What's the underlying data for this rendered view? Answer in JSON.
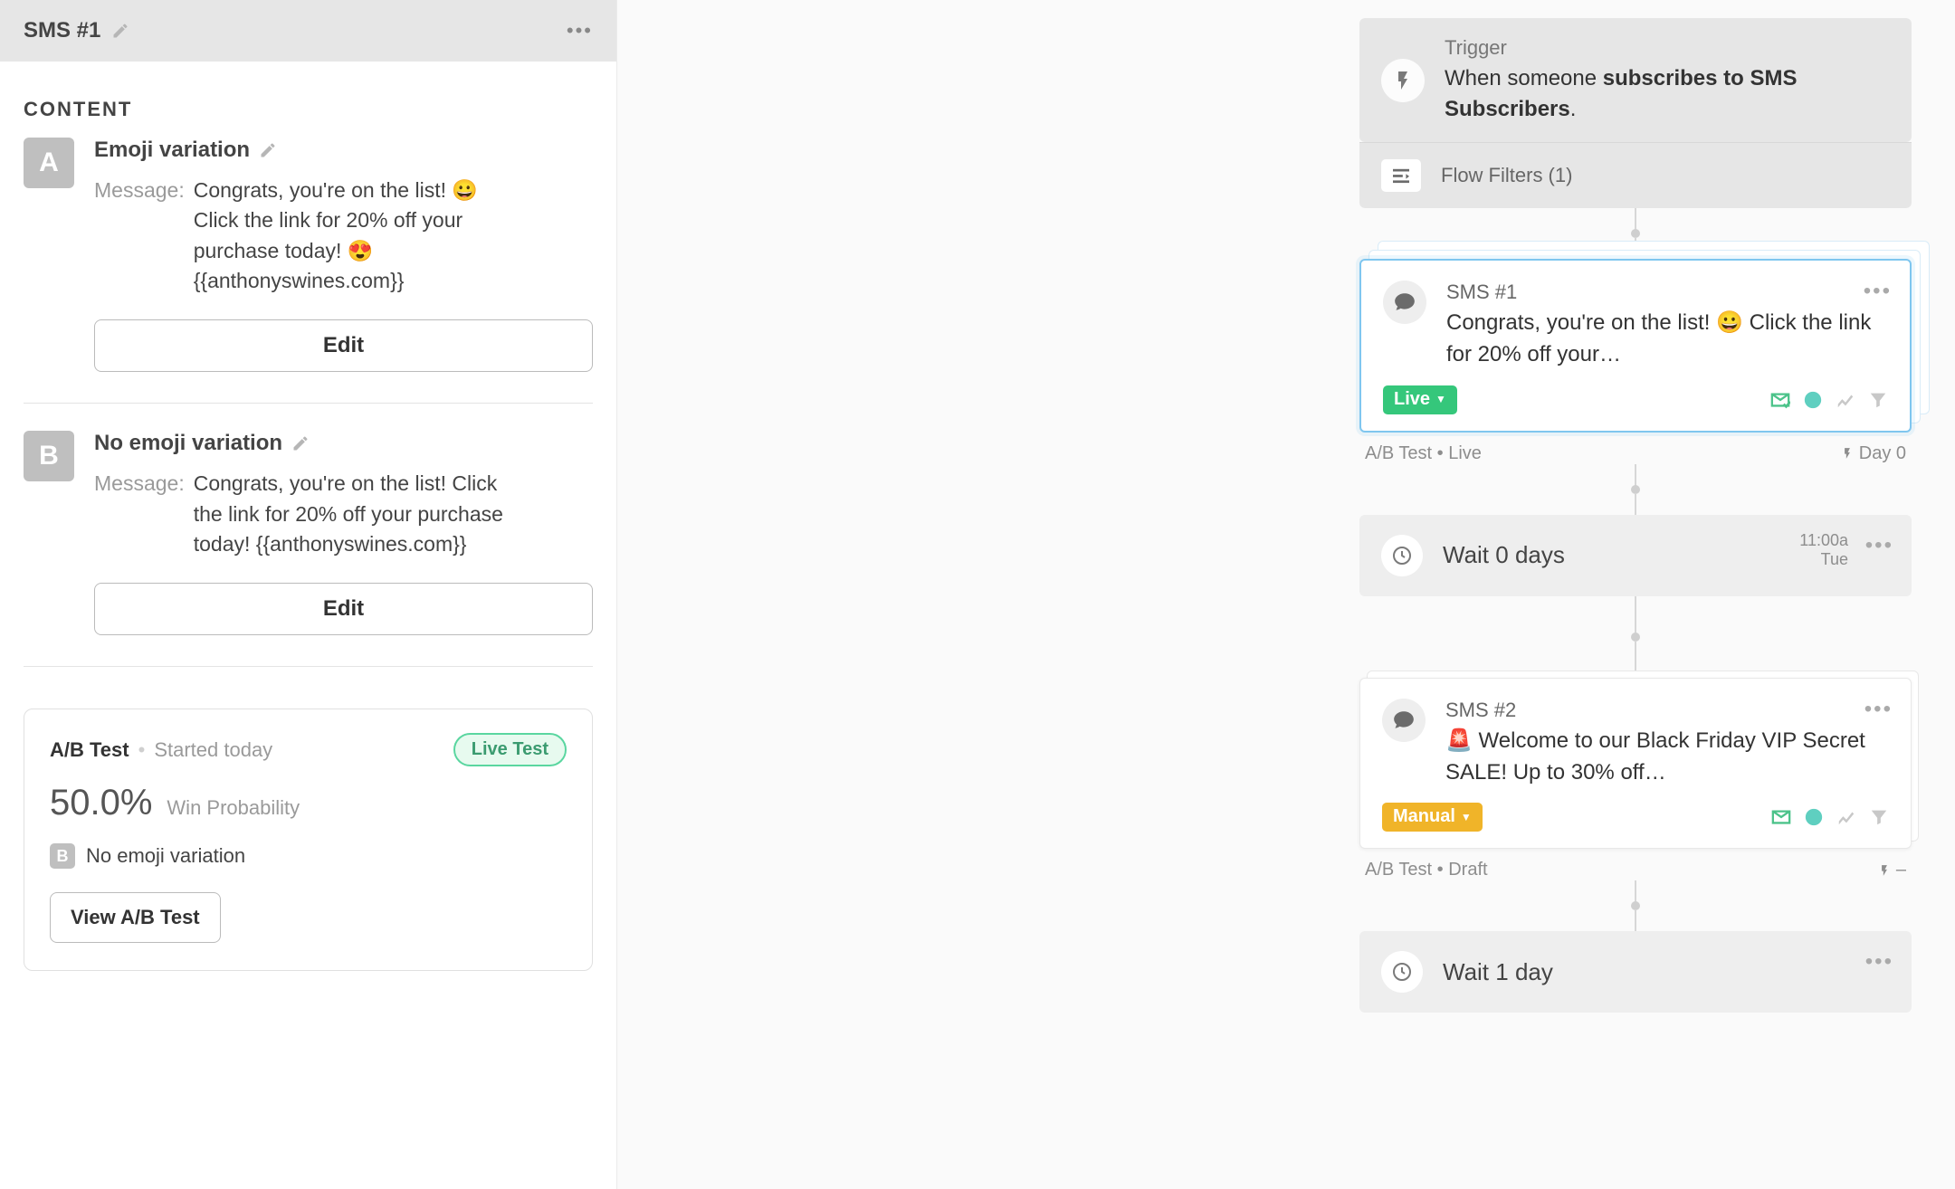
{
  "sidebar": {
    "title": "SMS #1",
    "section_heading": "CONTENT",
    "variations": [
      {
        "badge": "A",
        "name": "Emoji variation",
        "msg_label": "Message:",
        "msg": "Congrats, you're on the list! 😀 Click the link for 20% off your purchase today! 😍 {{anthonyswines.com}}",
        "edit_label": "Edit"
      },
      {
        "badge": "B",
        "name": "No emoji variation",
        "msg_label": "Message:",
        "msg": "Congrats, you're on the list! Click the link for 20% off your purchase today! {{anthonyswines.com}}",
        "edit_label": "Edit"
      }
    ],
    "ab": {
      "title": "A/B Test",
      "started": "Started today",
      "pill": "Live Test",
      "pct": "50.0%",
      "pct_label": "Win Probability",
      "winning_badge": "B",
      "winning_name": "No emoji variation",
      "view_label": "View A/B Test"
    }
  },
  "flow": {
    "trigger": {
      "label": "Trigger",
      "desc_prefix": "When someone ",
      "desc_bold": "subscribes to SMS Subscribers",
      "desc_suffix": ".",
      "filters_label": "Flow Filters (1)"
    },
    "sms1": {
      "title": "SMS #1",
      "msg": "Congrats, you're on the list! 😀 Click the link for 20% off your…",
      "status": "Live",
      "meta_left": "A/B Test • Live",
      "meta_right": "Day 0"
    },
    "wait1": {
      "text": "Wait 0 days",
      "time1": "11:00a",
      "time2": "Tue"
    },
    "sms2": {
      "title": "SMS #2",
      "msg": "🚨 Welcome to our Black Friday VIP Secret SALE! Up to 30% off…",
      "status": "Manual",
      "meta_left": "A/B Test • Draft",
      "meta_right": "–"
    },
    "wait2": {
      "text": "Wait 1 day"
    }
  }
}
